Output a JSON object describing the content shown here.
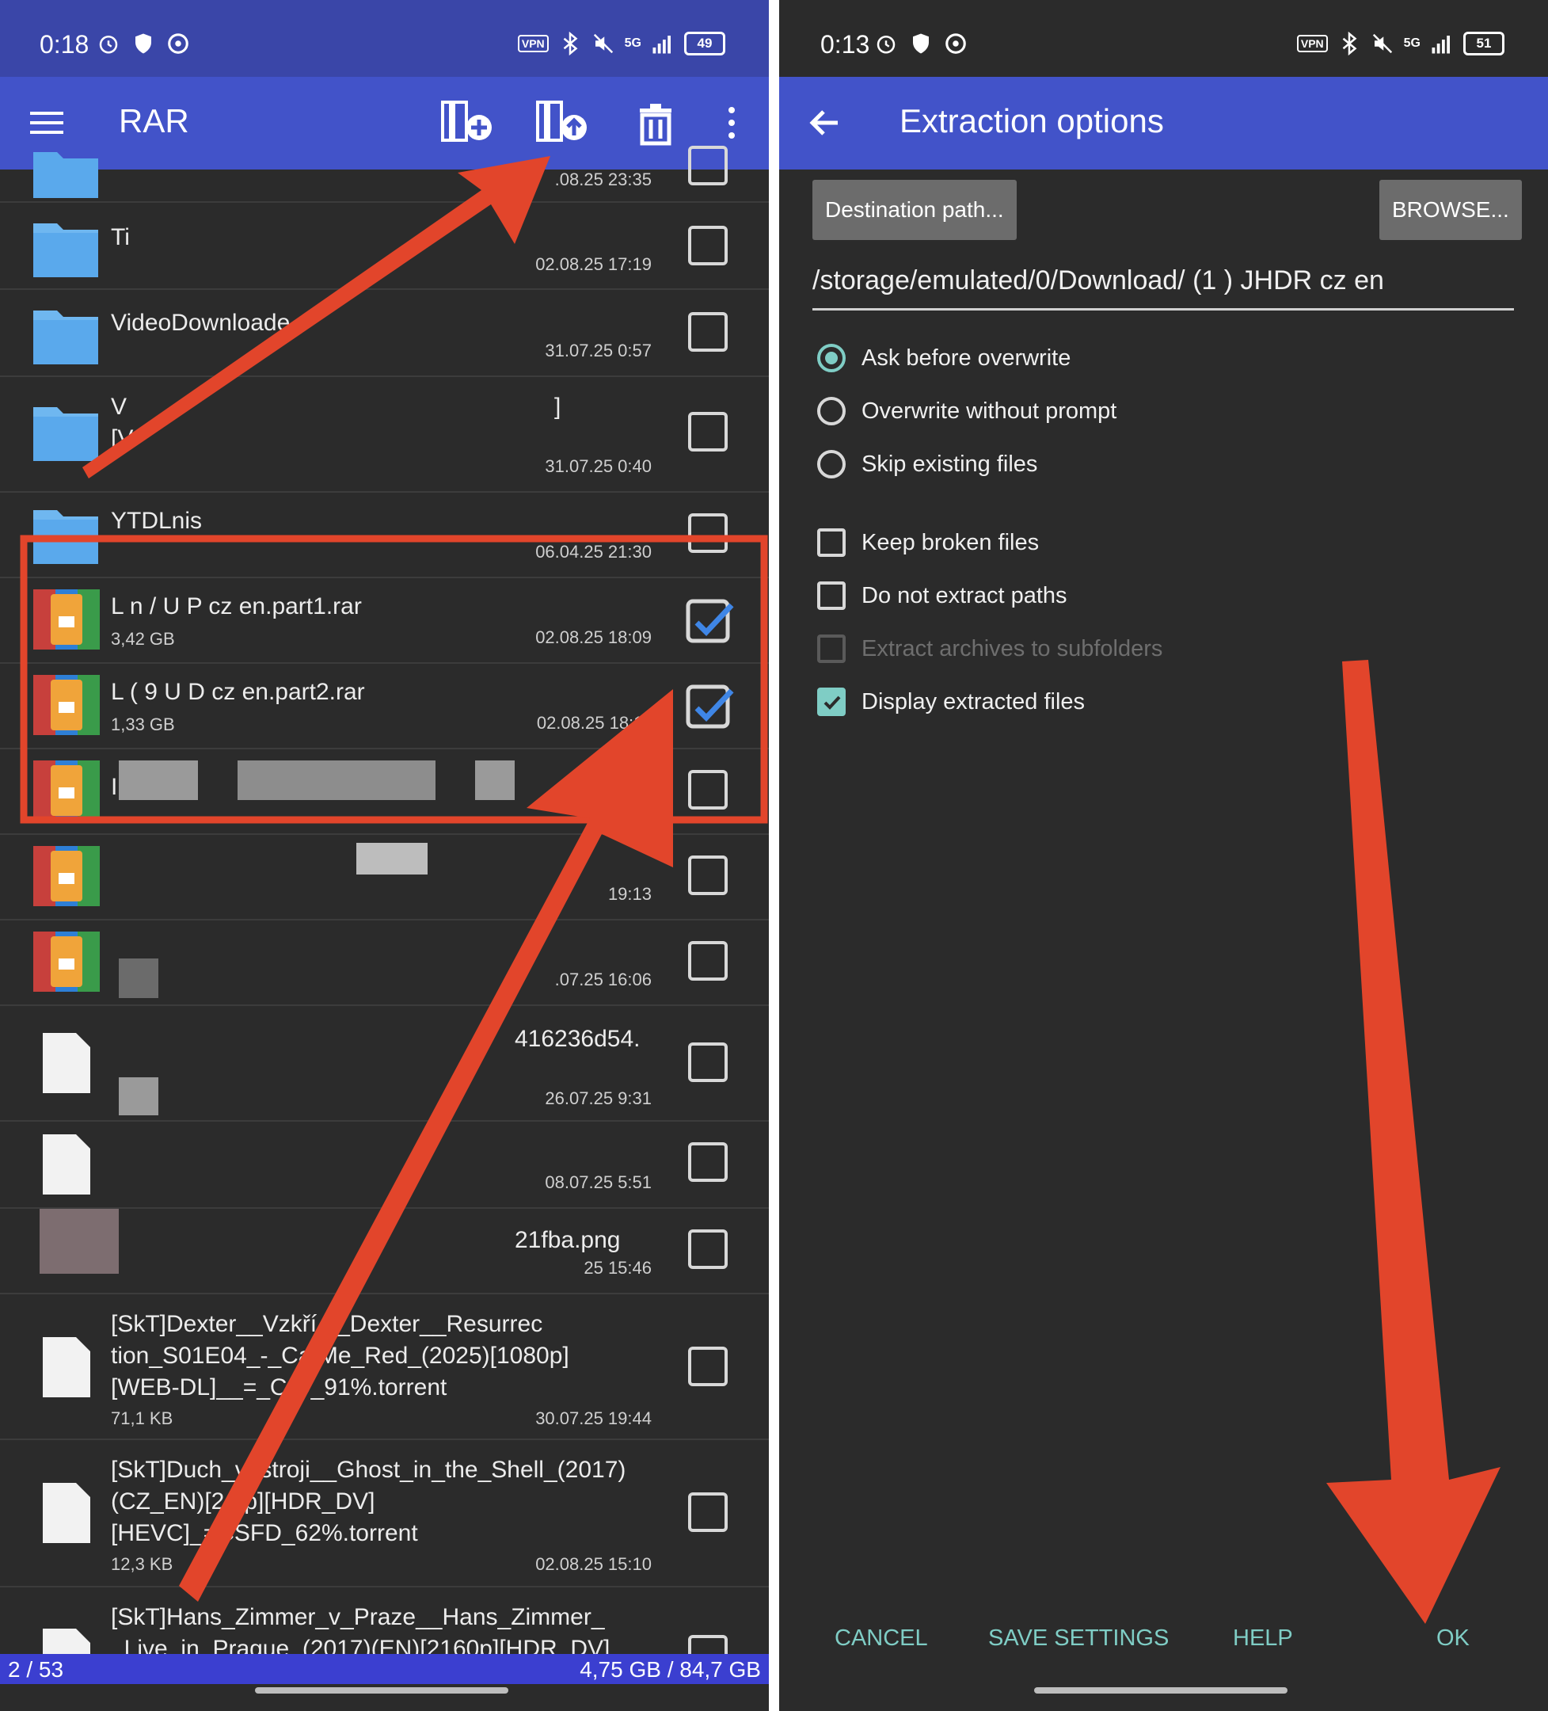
{
  "left": {
    "status": {
      "time": "0:18",
      "battery": "49",
      "network": "5G",
      "vpn": "VPN"
    },
    "appbar": {
      "title": "RAR"
    },
    "rows": [
      {
        "name": "",
        "size": "",
        "date": ".08.25 23:35"
      },
      {
        "name": "Ti",
        "size": "",
        "date": "02.08.25 17:19"
      },
      {
        "name": "VideoDownloade",
        "size": "",
        "date": "31.07.25 0:57"
      },
      {
        "name": "V",
        "name2": "[V",
        "name_tail": "]",
        "size": "",
        "date": "31.07.25 0:40"
      },
      {
        "name": "YTDLnis",
        "size": "",
        "date": "06.04.25 21:30"
      },
      {
        "name": "L  n   / U  P cz en.part1.rar",
        "size": "3,42 GB",
        "date": "02.08.25 18:09"
      },
      {
        "name": "L  (    9  U  D  cz en.part2.rar",
        "size": "1,33 GB",
        "date": "02.08.25 18:11"
      },
      {
        "name": "I",
        "size": "",
        "date": ""
      },
      {
        "name": "",
        "size": "",
        "date": "19:13"
      },
      {
        "name": "",
        "size": "",
        "date": ".07.25 16:06"
      },
      {
        "name": "416236d54.",
        "size": "",
        "date": "26.07.25 9:31"
      },
      {
        "name": "",
        "size": "",
        "date": "08.07.25 5:51"
      },
      {
        "name": "21fba.png",
        "size": "",
        "date": "25 15:46"
      },
      {
        "name": "[SkT]Dexter__Vzkří  __Dexter__Resurrec",
        "name2": "tion_S01E04_-_Ca  Me_Red_(2025)[1080p]",
        "name3": "[WEB-DL]__=_C  D_91%.torrent",
        "size": "71,1 KB",
        "date": "30.07.25 19:44"
      },
      {
        "name": "[SkT]Duch_v_stroji__Ghost_in_the_Shell_(2017)",
        "name2": "(CZ_EN)[2  0p][HDR_DV]",
        "name3": "[HEVC]_=CSFD_62%.torrent",
        "size": "12,3 KB",
        "date": "02.08.25 15:10"
      },
      {
        "name": "[SkT]Hans_Zimmer_v_Praze__Hans_Zimmer_",
        "name2": "_Live_in_Prague_(2017)(EN)[2160p][HDR_DV]",
        "size": "",
        "date": ""
      }
    ],
    "footer": {
      "count": "2 / 53",
      "storage": "4,75 GB / 84,7 GB"
    }
  },
  "right": {
    "status": {
      "time": "0:13",
      "battery": "51",
      "network": "5G",
      "vpn": "VPN"
    },
    "appbar": {
      "title": "Extraction options"
    },
    "destination_button": "Destination path...",
    "browse_button": "BROWSE...",
    "path_value": "/storage/emulated/0/Download/  (1  ) JHDR cz en",
    "radio_options": [
      {
        "label": "Ask before overwrite",
        "selected": true
      },
      {
        "label": "Overwrite without prompt",
        "selected": false
      },
      {
        "label": "Skip existing files",
        "selected": false
      }
    ],
    "checkbox_options": [
      {
        "label": "Keep broken files",
        "checked": false,
        "disabled": false
      },
      {
        "label": "Do not extract paths",
        "checked": false,
        "disabled": false
      },
      {
        "label": "Extract archives to subfolders",
        "checked": false,
        "disabled": true
      },
      {
        "label": "Display extracted files",
        "checked": true,
        "disabled": false
      }
    ],
    "actions": {
      "cancel": "CANCEL",
      "save": "SAVE SETTINGS",
      "help": "HELP",
      "ok": "OK"
    }
  },
  "colors": {
    "appbar": "#4253c9",
    "statusbar": "#3a46a8",
    "accent": "#7fcdc5",
    "annotation": "#e2452b",
    "check_blue": "#3f86e6"
  }
}
